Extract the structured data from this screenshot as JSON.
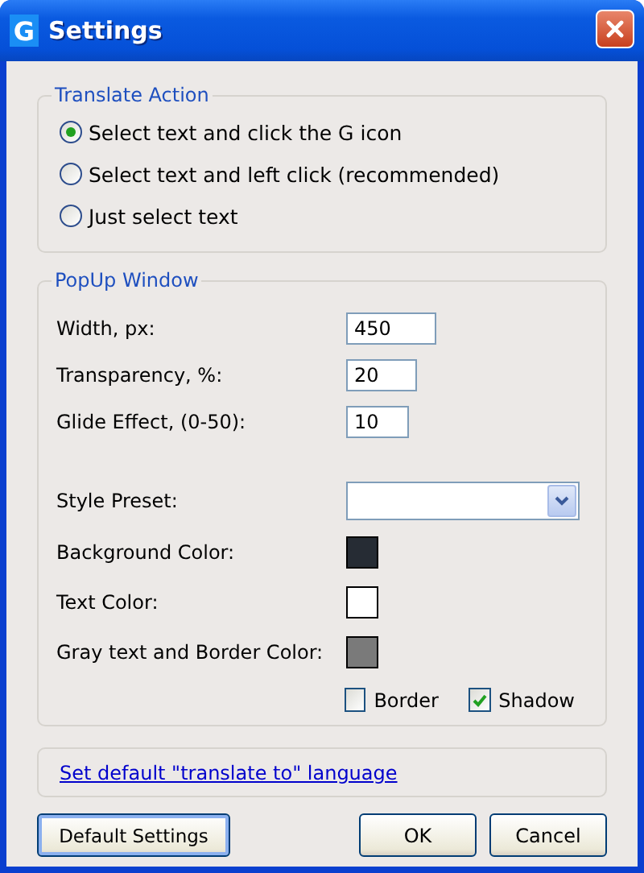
{
  "window": {
    "title": "Settings",
    "app_letter": "G"
  },
  "translate_action": {
    "title": "Translate Action",
    "options": [
      {
        "label": "Select text and click the G icon",
        "selected": true
      },
      {
        "label": "Select text and left click (recommended)",
        "selected": false
      },
      {
        "label": "Just select text",
        "selected": false
      }
    ]
  },
  "popup_window": {
    "title": "PopUp Window",
    "fields": [
      {
        "kind": "text",
        "label": "Width, px:",
        "value": "450"
      },
      {
        "kind": "text",
        "label": "Transparency, %:",
        "value": "20"
      },
      {
        "kind": "text",
        "label": "Glide Effect, (0-50):",
        "value": "10"
      },
      {
        "kind": "select",
        "label": "Style Preset:"
      },
      {
        "kind": "color",
        "label": "Background Color:",
        "color": "#262c34"
      },
      {
        "kind": "color",
        "label": "Text Color:",
        "color": "#ffffff"
      },
      {
        "kind": "color",
        "label": "Gray text and Border Color:",
        "color": "#7a7a7a"
      }
    ],
    "checkboxes": [
      {
        "label": "Border",
        "checked": false
      },
      {
        "label": "Shadow",
        "checked": true
      }
    ]
  },
  "link": "Set default \"translate to\" language",
  "buttons": [
    {
      "label": "Default Settings",
      "kind": "left"
    },
    {
      "label": "OK",
      "kind": "right"
    },
    {
      "label": "Cancel",
      "kind": "right"
    }
  ]
}
